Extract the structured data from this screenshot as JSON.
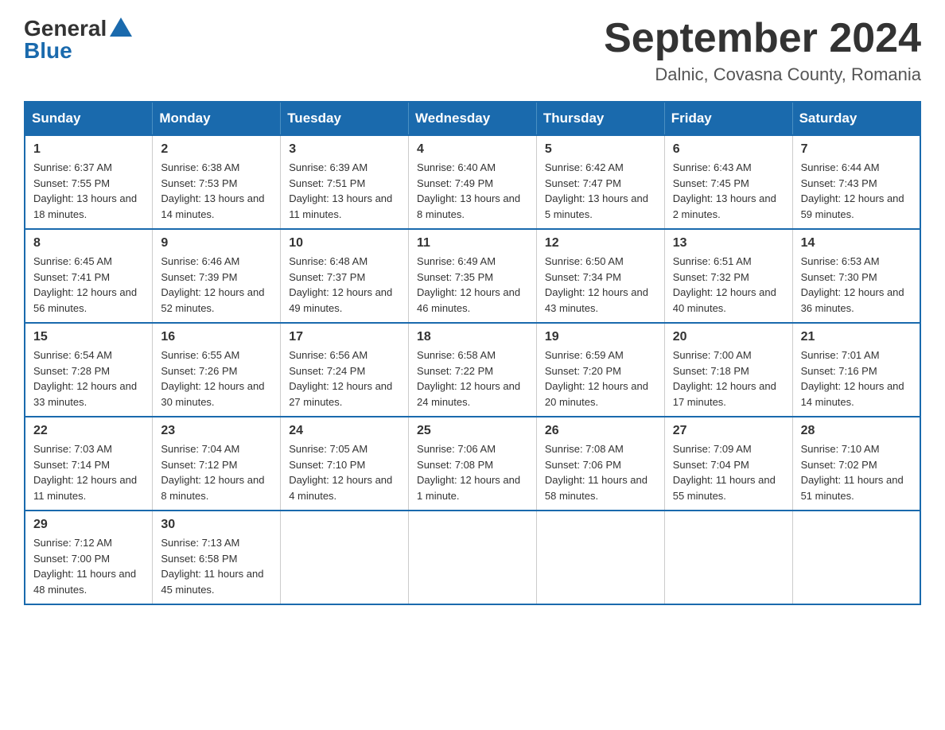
{
  "logo": {
    "general": "General",
    "blue": "Blue"
  },
  "header": {
    "title": "September 2024",
    "location": "Dalnic, Covasna County, Romania"
  },
  "weekdays": [
    "Sunday",
    "Monday",
    "Tuesday",
    "Wednesday",
    "Thursday",
    "Friday",
    "Saturday"
  ],
  "weeks": [
    [
      {
        "day": "1",
        "sunrise": "6:37 AM",
        "sunset": "7:55 PM",
        "daylight": "13 hours and 18 minutes."
      },
      {
        "day": "2",
        "sunrise": "6:38 AM",
        "sunset": "7:53 PM",
        "daylight": "13 hours and 14 minutes."
      },
      {
        "day": "3",
        "sunrise": "6:39 AM",
        "sunset": "7:51 PM",
        "daylight": "13 hours and 11 minutes."
      },
      {
        "day": "4",
        "sunrise": "6:40 AM",
        "sunset": "7:49 PM",
        "daylight": "13 hours and 8 minutes."
      },
      {
        "day": "5",
        "sunrise": "6:42 AM",
        "sunset": "7:47 PM",
        "daylight": "13 hours and 5 minutes."
      },
      {
        "day": "6",
        "sunrise": "6:43 AM",
        "sunset": "7:45 PM",
        "daylight": "13 hours and 2 minutes."
      },
      {
        "day": "7",
        "sunrise": "6:44 AM",
        "sunset": "7:43 PM",
        "daylight": "12 hours and 59 minutes."
      }
    ],
    [
      {
        "day": "8",
        "sunrise": "6:45 AM",
        "sunset": "7:41 PM",
        "daylight": "12 hours and 56 minutes."
      },
      {
        "day": "9",
        "sunrise": "6:46 AM",
        "sunset": "7:39 PM",
        "daylight": "12 hours and 52 minutes."
      },
      {
        "day": "10",
        "sunrise": "6:48 AM",
        "sunset": "7:37 PM",
        "daylight": "12 hours and 49 minutes."
      },
      {
        "day": "11",
        "sunrise": "6:49 AM",
        "sunset": "7:35 PM",
        "daylight": "12 hours and 46 minutes."
      },
      {
        "day": "12",
        "sunrise": "6:50 AM",
        "sunset": "7:34 PM",
        "daylight": "12 hours and 43 minutes."
      },
      {
        "day": "13",
        "sunrise": "6:51 AM",
        "sunset": "7:32 PM",
        "daylight": "12 hours and 40 minutes."
      },
      {
        "day": "14",
        "sunrise": "6:53 AM",
        "sunset": "7:30 PM",
        "daylight": "12 hours and 36 minutes."
      }
    ],
    [
      {
        "day": "15",
        "sunrise": "6:54 AM",
        "sunset": "7:28 PM",
        "daylight": "12 hours and 33 minutes."
      },
      {
        "day": "16",
        "sunrise": "6:55 AM",
        "sunset": "7:26 PM",
        "daylight": "12 hours and 30 minutes."
      },
      {
        "day": "17",
        "sunrise": "6:56 AM",
        "sunset": "7:24 PM",
        "daylight": "12 hours and 27 minutes."
      },
      {
        "day": "18",
        "sunrise": "6:58 AM",
        "sunset": "7:22 PM",
        "daylight": "12 hours and 24 minutes."
      },
      {
        "day": "19",
        "sunrise": "6:59 AM",
        "sunset": "7:20 PM",
        "daylight": "12 hours and 20 minutes."
      },
      {
        "day": "20",
        "sunrise": "7:00 AM",
        "sunset": "7:18 PM",
        "daylight": "12 hours and 17 minutes."
      },
      {
        "day": "21",
        "sunrise": "7:01 AM",
        "sunset": "7:16 PM",
        "daylight": "12 hours and 14 minutes."
      }
    ],
    [
      {
        "day": "22",
        "sunrise": "7:03 AM",
        "sunset": "7:14 PM",
        "daylight": "12 hours and 11 minutes."
      },
      {
        "day": "23",
        "sunrise": "7:04 AM",
        "sunset": "7:12 PM",
        "daylight": "12 hours and 8 minutes."
      },
      {
        "day": "24",
        "sunrise": "7:05 AM",
        "sunset": "7:10 PM",
        "daylight": "12 hours and 4 minutes."
      },
      {
        "day": "25",
        "sunrise": "7:06 AM",
        "sunset": "7:08 PM",
        "daylight": "12 hours and 1 minute."
      },
      {
        "day": "26",
        "sunrise": "7:08 AM",
        "sunset": "7:06 PM",
        "daylight": "11 hours and 58 minutes."
      },
      {
        "day": "27",
        "sunrise": "7:09 AM",
        "sunset": "7:04 PM",
        "daylight": "11 hours and 55 minutes."
      },
      {
        "day": "28",
        "sunrise": "7:10 AM",
        "sunset": "7:02 PM",
        "daylight": "11 hours and 51 minutes."
      }
    ],
    [
      {
        "day": "29",
        "sunrise": "7:12 AM",
        "sunset": "7:00 PM",
        "daylight": "11 hours and 48 minutes."
      },
      {
        "day": "30",
        "sunrise": "7:13 AM",
        "sunset": "6:58 PM",
        "daylight": "11 hours and 45 minutes."
      },
      null,
      null,
      null,
      null,
      null
    ]
  ]
}
